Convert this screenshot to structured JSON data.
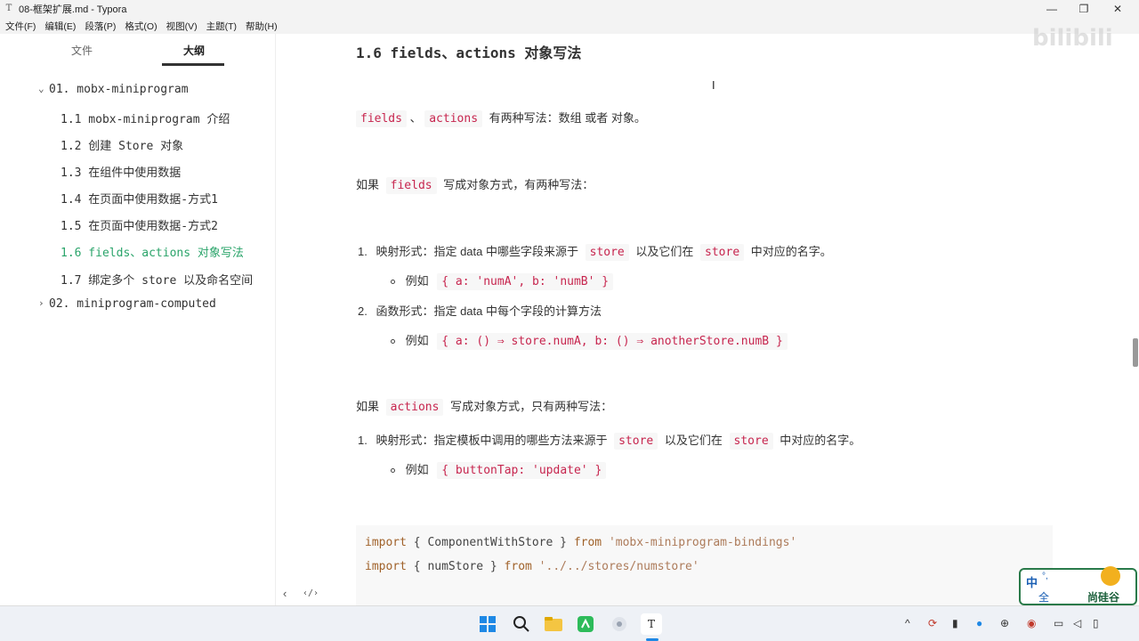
{
  "window": {
    "title": "08-框架扩展.md - Typora",
    "app_icon": "T"
  },
  "menu": [
    "文件(F)",
    "编辑(E)",
    "段落(P)",
    "格式(O)",
    "视图(V)",
    "主题(T)",
    "帮助(H)"
  ],
  "sidebar": {
    "tabs": [
      "文件",
      "大纲"
    ],
    "outline": [
      {
        "label": "01. mobx-miniprogram"
      },
      {
        "label": "1.1 mobx-miniprogram 介绍"
      },
      {
        "label": "1.2 创建 Store 对象"
      },
      {
        "label": "1.3 在组件中使用数据"
      },
      {
        "label": "1.4 在页面中使用数据-方式1"
      },
      {
        "label": "1.5 在页面中使用数据-方式2"
      },
      {
        "label": "1.6 fields、actions 对象写法"
      },
      {
        "label": "1.7 绑定多个 store 以及命名空间"
      },
      {
        "label": "02. miniprogram-computed"
      }
    ],
    "footer_left": "‹",
    "footer_right": "‹/›"
  },
  "doc": {
    "heading": "1.6 fields、actions 对象写法",
    "p1": {
      "code1": "fields",
      "sep": "、",
      "code2": "actions",
      "text": "有两种写法：数组 或者 对象。"
    },
    "p2": {
      "pre": "如果",
      "code": "fields",
      "post": "写成对象方式，有两种写法："
    },
    "list1": [
      {
        "num": "1.",
        "pre": "映射形式：指定 data 中哪些字段来源于",
        "code1": "store",
        "mid": "以及它们在",
        "code2": "store",
        "post": "中对应的名字。",
        "example_label": "例如",
        "example_code": "{ a: 'numA', b: 'numB' }"
      },
      {
        "num": "2.",
        "pre": "函数形式：指定 data 中每个字段的计算方法",
        "example_label": "例如",
        "example_code": "{ a: () ⇒ store.numA, b: () ⇒ anotherStore.numB }"
      }
    ],
    "p3": {
      "pre": "如果",
      "code": "actions",
      "post": "写成对象方式，只有两种写法："
    },
    "list2": [
      {
        "num": "1.",
        "pre": "映射形式：指定模板中调用的哪些方法来源于",
        "code1": "store",
        "mid": "以及它们在",
        "code2": "store",
        "post": "中对应的名字。",
        "example_label": "例如",
        "example_code": "{ buttonTap: 'update' }"
      }
    ],
    "codeblock": [
      {
        "kw": "import",
        "body": " { ComponentWithStore } ",
        "from": "from",
        "str": " 'mobx-miniprogram-bindings'"
      },
      {
        "kw": "import",
        "body": " { numStore } ",
        "from": "from",
        "str": " '../../stores/numstore'"
      }
    ]
  },
  "watermark": "bilibili",
  "ime": {
    "lang": "中",
    "mode": "°,",
    "width": "全",
    "brand": "尚硅谷"
  },
  "taskbar": {
    "icons": [
      "windows-start-icon",
      "search-icon",
      "file-explorer-icon",
      "wechat-devtools-icon",
      "app-icon",
      "typora-icon"
    ],
    "tray_icons": [
      "chevron-up-icon",
      "sync-icon",
      "pin-icon",
      "mic-icon",
      "input-icon",
      "antivirus-icon",
      "display-icon",
      "volume-icon",
      "battery-icon"
    ]
  },
  "colors": {
    "accent_green": "#2aa46a",
    "inline_code": "#c7254e"
  }
}
